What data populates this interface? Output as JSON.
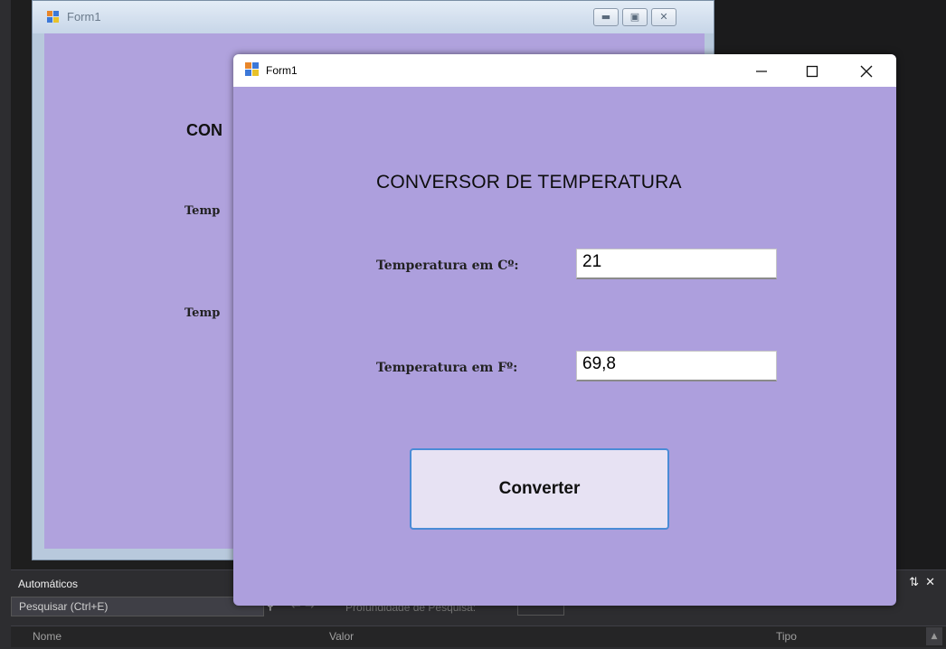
{
  "back_form": {
    "title": "Form1",
    "heading_fragment": "CON",
    "label_fragment_1": "Temp",
    "label_fragment_2": "Temp"
  },
  "front_form": {
    "title": "Form1",
    "heading": "CONVERSOR DE TEMPERATURA",
    "celsius_label": "Temperatura em Cº:",
    "celsius_value": "21",
    "fahrenheit_label": "Temperatura em Fº:",
    "fahrenheit_value": "69,8",
    "convert_button": "Converter",
    "window_controls": {
      "minimize": "minimize-icon",
      "maximize": "maximize-icon",
      "close": "close-icon"
    }
  },
  "autos_panel": {
    "title": "Automáticos",
    "search_placeholder": "Pesquisar (Ctrl+E)",
    "search_depth_label": "Profundidade de Pesquisa:",
    "columns": [
      "Nome",
      "Valor",
      "Tipo"
    ]
  },
  "colors": {
    "form_background": "#ad9fdd",
    "button_background": "#e7e2f3",
    "button_border": "#4a8bd6",
    "ide_background": "#1e1e1e"
  }
}
